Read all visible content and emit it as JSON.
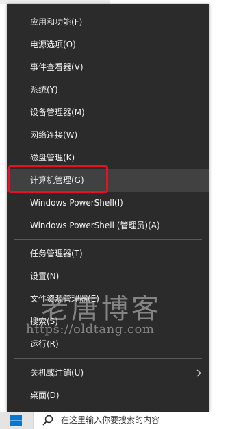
{
  "menu": {
    "items": [
      {
        "label": "应用和功能(F)"
      },
      {
        "label": "电源选项(O)"
      },
      {
        "label": "事件查看器(V)"
      },
      {
        "label": "系统(Y)"
      },
      {
        "label": "设备管理器(M)"
      },
      {
        "label": "网络连接(W)"
      },
      {
        "label": "磁盘管理(K)"
      },
      {
        "label": "计算机管理(G)"
      },
      {
        "label": "Windows PowerShell(I)"
      },
      {
        "label": "Windows PowerShell (管理员)(A)"
      },
      {
        "label": "任务管理器(T)"
      },
      {
        "label": "设置(N)"
      },
      {
        "label": "文件资源管理器(E)"
      },
      {
        "label": "搜索(S)"
      },
      {
        "label": "运行(R)"
      },
      {
        "label": "关机或注销(U)"
      },
      {
        "label": "桌面(D)"
      }
    ],
    "hovered_item": "计算机管理(G)"
  },
  "watermark": {
    "title": "老唐博客",
    "url": "https://oldtang.com"
  },
  "taskbar": {
    "search_placeholder": "在这里输入你要搜索的内容"
  },
  "colors": {
    "menu_bg": "#2b2b2b",
    "hover_bg": "#414141",
    "highlight_border": "#e81123",
    "windows_blue": "#0078d7"
  },
  "icons": [
    "chevron-right-icon",
    "windows-logo-icon",
    "search-icon"
  ]
}
